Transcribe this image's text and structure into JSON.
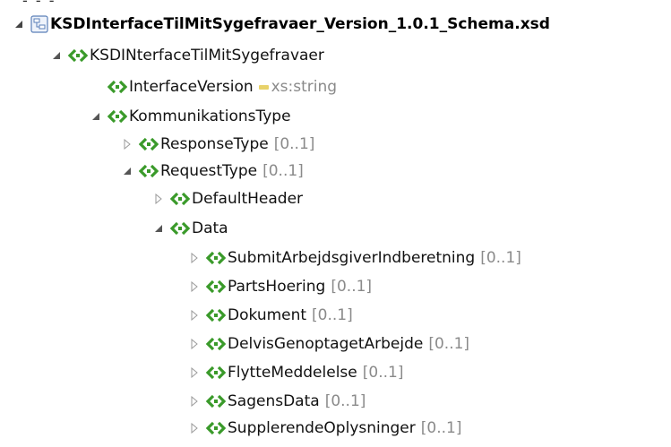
{
  "tree": {
    "root": {
      "label": "KSDInterfaceTilMitSygefravaer_Version_1.0.1_Schema.xsd",
      "icon": "xsd-schema-icon",
      "expanded": true
    },
    "nodes": [
      {
        "label": "KSDINterfaceTilMitSygefravaer",
        "cardinality": "",
        "type": "",
        "expanded": true,
        "has_children": true
      },
      {
        "label": "InterfaceVersion",
        "cardinality": "",
        "type": "xs:string",
        "expanded": false,
        "has_children": false
      },
      {
        "label": "KommunikationsType",
        "cardinality": "",
        "type": "",
        "expanded": true,
        "has_children": true
      },
      {
        "label": "ResponseType",
        "cardinality": "[0..1]",
        "type": "",
        "expanded": false,
        "has_children": true
      },
      {
        "label": "RequestType",
        "cardinality": "[0..1]",
        "type": "",
        "expanded": true,
        "has_children": true
      },
      {
        "label": "DefaultHeader",
        "cardinality": "",
        "type": "",
        "expanded": false,
        "has_children": true
      },
      {
        "label": "Data",
        "cardinality": "",
        "type": "",
        "expanded": true,
        "has_children": true
      },
      {
        "label": "SubmitArbejdsgiverIndberetning",
        "cardinality": "[0..1]",
        "type": "",
        "expanded": false,
        "has_children": true
      },
      {
        "label": "PartsHoering",
        "cardinality": "[0..1]",
        "type": "",
        "expanded": false,
        "has_children": true
      },
      {
        "label": "Dokument",
        "cardinality": "[0..1]",
        "type": "",
        "expanded": false,
        "has_children": true
      },
      {
        "label": "DelvisGenoptagetArbejde",
        "cardinality": "[0..1]",
        "type": "",
        "expanded": false,
        "has_children": true
      },
      {
        "label": "FlytteMeddelelse",
        "cardinality": "[0..1]",
        "type": "",
        "expanded": false,
        "has_children": true
      },
      {
        "label": "SagensData",
        "cardinality": "[0..1]",
        "type": "",
        "expanded": false,
        "has_children": true
      },
      {
        "label": "SupplerendeOplysninger",
        "cardinality": "[0..1]",
        "type": "",
        "expanded": false,
        "has_children": true
      }
    ]
  },
  "colors": {
    "element_icon": "#3a9a2a",
    "cardinality_text": "#8a8a8a",
    "type_marker": "#e8d26a",
    "expander": "#555555"
  }
}
